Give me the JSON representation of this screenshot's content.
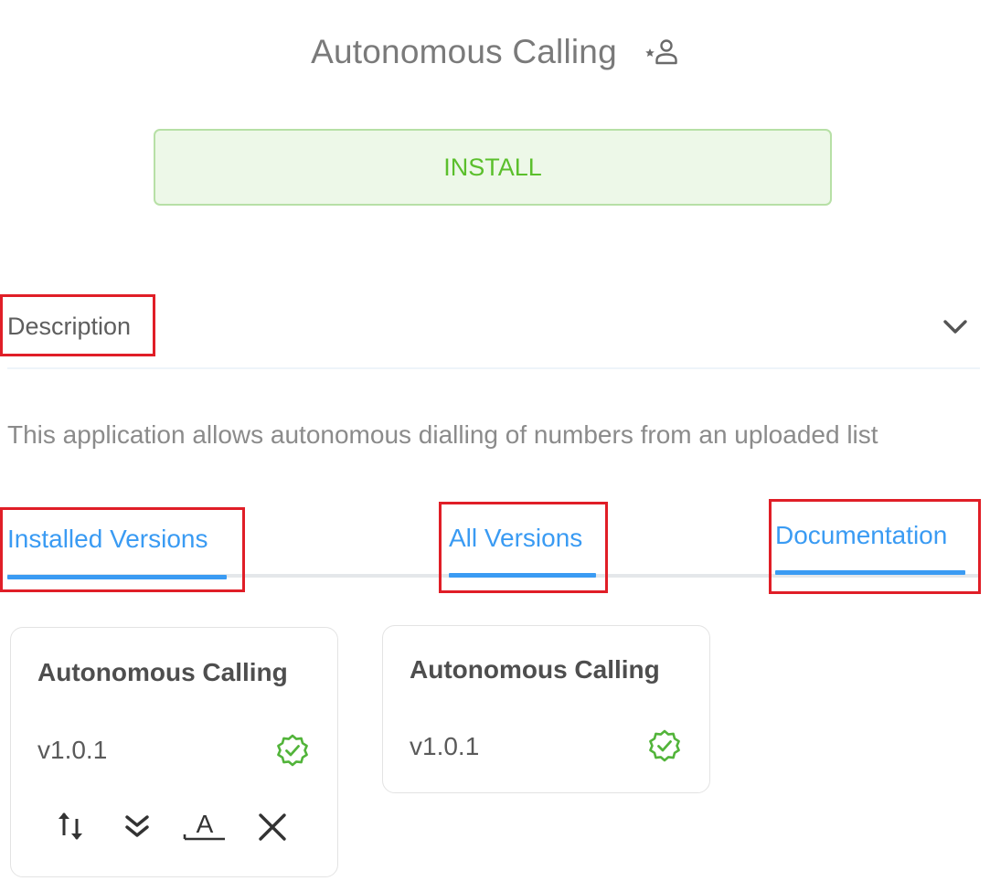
{
  "app": {
    "title": "Autonomous Calling",
    "install_label": "INSTALL"
  },
  "description": {
    "header": "Description",
    "text": "This application allows autonomous dialling of numbers from an uploaded list"
  },
  "tabs": [
    {
      "label": "Installed Versions"
    },
    {
      "label": "All Versions"
    },
    {
      "label": "Documentation"
    }
  ],
  "cards": [
    {
      "title": "Autonomous Calling",
      "version": "v1.0.1",
      "actions": [
        "sort-icon",
        "double-chevron-down-icon",
        "text-format-icon",
        "close-icon"
      ]
    },
    {
      "title": "Autonomous Calling",
      "version": "v1.0.1"
    }
  ],
  "colors": {
    "accent": "#3a9bf3",
    "install_text": "#5bbf2c",
    "install_bg": "#edf8e8",
    "verified": "#52b43a",
    "highlight": "#e01e27"
  }
}
